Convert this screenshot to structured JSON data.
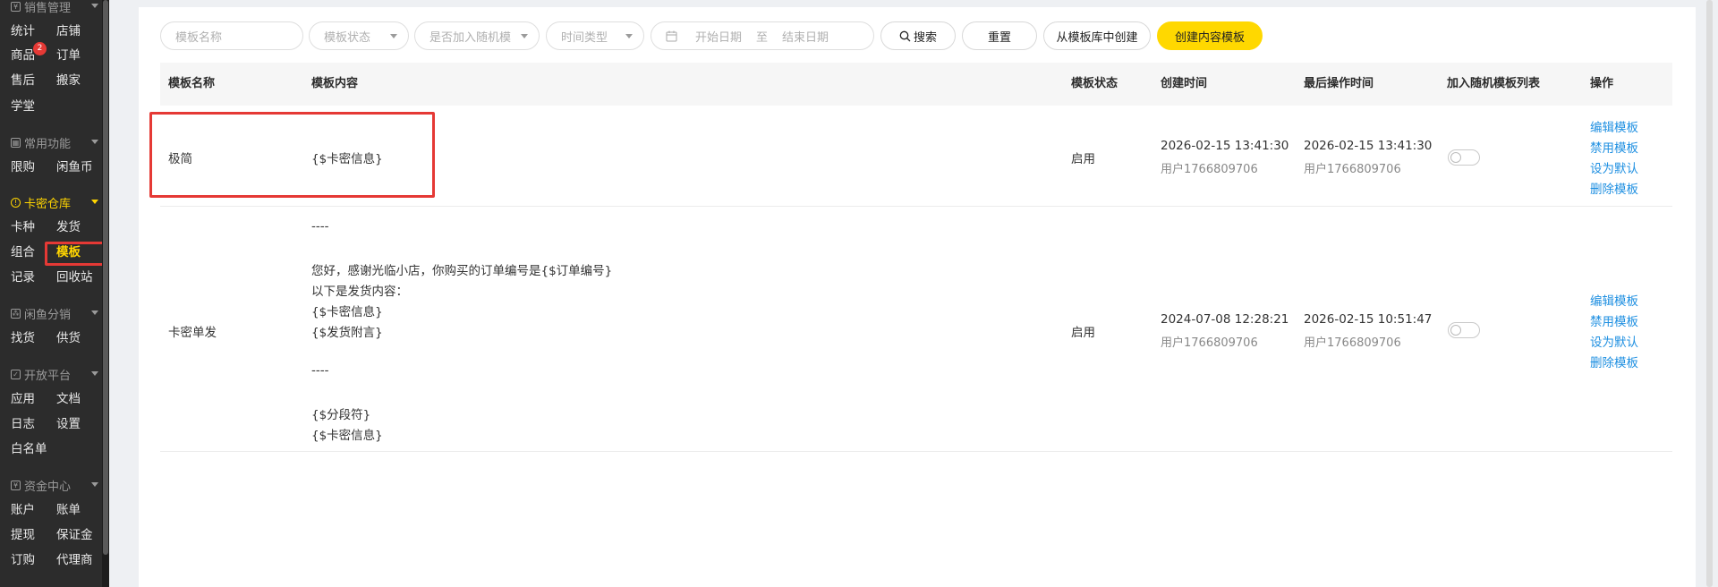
{
  "sidebar": {
    "sections": [
      {
        "title": "销售管理"
      },
      {
        "title": "常用功能"
      },
      {
        "title": "卡密仓库"
      },
      {
        "title": "闲鱼分销"
      },
      {
        "title": "开放平台"
      },
      {
        "title": "资金中心"
      }
    ],
    "items": [
      "统计",
      "店铺",
      "商品",
      "订单",
      "售后",
      "搬家",
      "学堂",
      "限购",
      "闲鱼币",
      "卡种",
      "发货",
      "组合",
      "模板",
      "记录",
      "回收站",
      "找货",
      "供货",
      "应用",
      "文档",
      "日志",
      "设置",
      "白名单",
      "账户",
      "账单",
      "提现",
      "保证金",
      "订购",
      "代理商"
    ],
    "goods_badge": "2",
    "active_item": "模板"
  },
  "filters": {
    "name_placeholder": "模板名称",
    "status_placeholder": "模板状态",
    "random_placeholder": "是否加入随机模",
    "time_type_placeholder": "时间类型",
    "start_date_placeholder": "开始日期",
    "date_sep": "至",
    "end_date_placeholder": "结束日期"
  },
  "buttons": {
    "search": "搜索",
    "reset": "重置",
    "from_library": "从模板库中创建",
    "create": "创建内容模板"
  },
  "table": {
    "headers": [
      "模板名称",
      "模板内容",
      "模板状态",
      "创建时间",
      "最后操作时间",
      "加入随机模板列表",
      "操作"
    ],
    "rows": [
      {
        "name": "极简",
        "content": [
          "{$卡密信息}"
        ],
        "status": "启用",
        "created": "2026-02-15 13:41:30",
        "created_by": "用户1766809706",
        "modified": "2026-02-15 13:41:30",
        "modified_by": "用户1766809706",
        "random_on": false,
        "actions": [
          "编辑模板",
          "禁用模板",
          "设为默认",
          "删除模板"
        ]
      },
      {
        "name": "卡密单发",
        "content": [
          "----",
          "",
          "您好，感谢光临小店，你购买的订单编号是{$订单编号}",
          "以下是发货内容：",
          "{$卡密信息}",
          "{$发货附言}",
          "",
          "----",
          "",
          "{$分段符}",
          "{$卡密信息}"
        ],
        "status": "启用",
        "created": "2024-07-08 12:28:21",
        "created_by": "用户1766809706",
        "modified": "2026-02-15 10:51:47",
        "modified_by": "用户1766809706",
        "random_on": false,
        "actions": [
          "编辑模板",
          "禁用模板",
          "设为默认",
          "删除模板"
        ]
      }
    ]
  }
}
